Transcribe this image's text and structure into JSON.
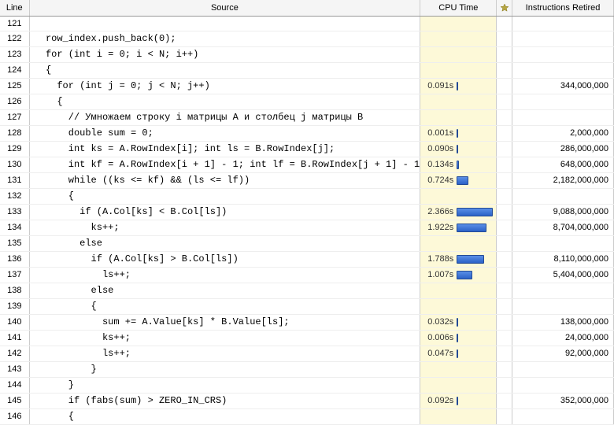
{
  "columns": {
    "line": "Line",
    "source": "Source",
    "cpu": "CPU Time",
    "instr": "Instructions Retired"
  },
  "max_cpu_s": 2.366,
  "rows": [
    {
      "line": 121,
      "code": ""
    },
    {
      "line": 122,
      "code": "  row_index.push_back(0);"
    },
    {
      "line": 123,
      "code": "  for (int i = 0; i < N; i++)"
    },
    {
      "line": 124,
      "code": "  {"
    },
    {
      "line": 125,
      "code": "    for (int j = 0; j < N; j++)",
      "cpu": "0.091s",
      "cpu_s": 0.091,
      "instr": "344,000,000"
    },
    {
      "line": 126,
      "code": "    {"
    },
    {
      "line": 127,
      "code": "      // Умножаем строку i матрицы A и столбец j матрицы B"
    },
    {
      "line": 128,
      "code": "      double sum = 0;",
      "cpu": "0.001s",
      "cpu_s": 0.001,
      "instr": "2,000,000"
    },
    {
      "line": 129,
      "code": "      int ks = A.RowIndex[i]; int ls = B.RowIndex[j];",
      "cpu": "0.090s",
      "cpu_s": 0.09,
      "instr": "286,000,000"
    },
    {
      "line": 130,
      "code": "      int kf = A.RowIndex[i + 1] - 1; int lf = B.RowIndex[j + 1] - 1",
      "cpu": "0.134s",
      "cpu_s": 0.134,
      "instr": "648,000,000"
    },
    {
      "line": 131,
      "code": "      while ((ks <= kf) && (ls <= lf))",
      "cpu": "0.724s",
      "cpu_s": 0.724,
      "instr": "2,182,000,000"
    },
    {
      "line": 132,
      "code": "      {"
    },
    {
      "line": 133,
      "code": "        if (A.Col[ks] < B.Col[ls])",
      "cpu": "2.366s",
      "cpu_s": 2.366,
      "instr": "9,088,000,000"
    },
    {
      "line": 134,
      "code": "          ks++;",
      "cpu": "1.922s",
      "cpu_s": 1.922,
      "instr": "8,704,000,000"
    },
    {
      "line": 135,
      "code": "        else"
    },
    {
      "line": 136,
      "code": "          if (A.Col[ks] > B.Col[ls])",
      "cpu": "1.788s",
      "cpu_s": 1.788,
      "instr": "8,110,000,000"
    },
    {
      "line": 137,
      "code": "            ls++;",
      "cpu": "1.007s",
      "cpu_s": 1.007,
      "instr": "5,404,000,000"
    },
    {
      "line": 138,
      "code": "          else"
    },
    {
      "line": 139,
      "code": "          {"
    },
    {
      "line": 140,
      "code": "            sum += A.Value[ks] * B.Value[ls];",
      "cpu": "0.032s",
      "cpu_s": 0.032,
      "instr": "138,000,000"
    },
    {
      "line": 141,
      "code": "            ks++;",
      "cpu": "0.006s",
      "cpu_s": 0.006,
      "instr": "24,000,000"
    },
    {
      "line": 142,
      "code": "            ls++;",
      "cpu": "0.047s",
      "cpu_s": 0.047,
      "instr": "92,000,000"
    },
    {
      "line": 143,
      "code": "          }"
    },
    {
      "line": 144,
      "code": "      }"
    },
    {
      "line": 145,
      "code": "      if (fabs(sum) > ZERO_IN_CRS)",
      "cpu": "0.092s",
      "cpu_s": 0.092,
      "instr": "352,000,000"
    },
    {
      "line": 146,
      "code": "      {"
    }
  ]
}
